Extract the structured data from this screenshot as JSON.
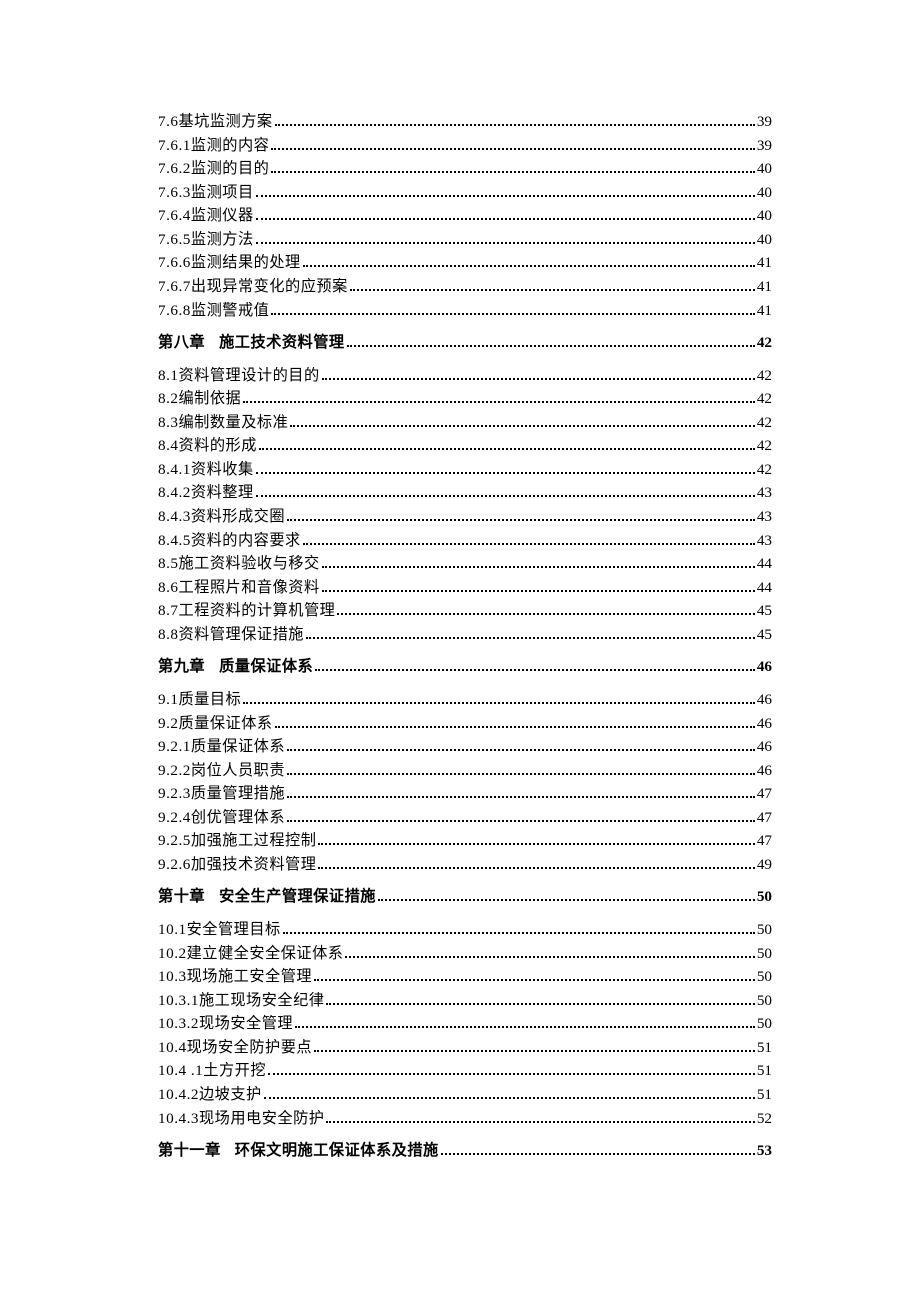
{
  "toc": [
    {
      "num": "7.6",
      "title": "基坑监测方案",
      "page": "39",
      "heading": false
    },
    {
      "num": "7.6.1",
      "title": "监测的内容",
      "page": "39",
      "heading": false
    },
    {
      "num": "7.6.2",
      "title": "监测的目的",
      "page": "40",
      "heading": false
    },
    {
      "num": "7.6.3",
      "title": "监测项目",
      "page": "40",
      "heading": false
    },
    {
      "num": "7.6.4",
      "title": "监测仪器",
      "page": "40",
      "heading": false
    },
    {
      "num": "7.6.5",
      "title": "监测方法",
      "page": "40",
      "heading": false
    },
    {
      "num": "7.6.6",
      "title": "监测结果的处理",
      "page": "41",
      "heading": false
    },
    {
      "num": "7.6.7",
      "title": "出现异常变化的应预案",
      "page": "41",
      "heading": false
    },
    {
      "num": "7.6.8",
      "title": "监测警戒值",
      "page": "41",
      "heading": false
    },
    {
      "num": "第八章",
      "title": "施工技术资料管理",
      "page": "42",
      "heading": true
    },
    {
      "num": "8.1",
      "title": "资料管理设计的目的",
      "page": "42",
      "heading": false
    },
    {
      "num": "8.2",
      "title": "编制依据",
      "page": "42",
      "heading": false
    },
    {
      "num": "8.3",
      "title": "编制数量及标准",
      "page": "42",
      "heading": false
    },
    {
      "num": "8.4",
      "title": "资料的形成",
      "page": "42",
      "heading": false
    },
    {
      "num": "8.4.1",
      "title": "资料收集",
      "page": "42",
      "heading": false
    },
    {
      "num": "8.4.2",
      "title": "资料整理",
      "page": "43",
      "heading": false
    },
    {
      "num": "8.4.3",
      "title": "资料形成交圈",
      "page": "43",
      "heading": false
    },
    {
      "num": "8.4.5",
      "title": "资料的内容要求",
      "page": "43",
      "heading": false
    },
    {
      "num": "8.5",
      "title": "施工资料验收与移交",
      "page": "44",
      "heading": false
    },
    {
      "num": "8.6",
      "title": "工程照片和音像资料",
      "page": "44",
      "heading": false
    },
    {
      "num": "8.7",
      "title": "工程资料的计算机管理",
      "page": "45",
      "heading": false
    },
    {
      "num": "8.8",
      "title": "资料管理保证措施",
      "page": "45",
      "heading": false
    },
    {
      "num": "第九章",
      "title": "质量保证体系",
      "page": "46",
      "heading": true
    },
    {
      "num": "9.1",
      "title": "质量目标",
      "page": "46",
      "heading": false
    },
    {
      "num": "9.2",
      "title": "质量保证体系",
      "page": "46",
      "heading": false
    },
    {
      "num": "9.2.1",
      "title": "质量保证体系 ",
      "page": "46",
      "heading": false
    },
    {
      "num": "9.2.2",
      "title": "岗位人员职责 ",
      "page": "46",
      "heading": false
    },
    {
      "num": "9.2.3",
      "title": "质量管理措施 ",
      "page": "47",
      "heading": false
    },
    {
      "num": "9.2.4",
      "title": "创优管理体系 ",
      "page": "47",
      "heading": false
    },
    {
      "num": "9.2.5",
      "title": "加强施工过程控制 ",
      "page": "47",
      "heading": false
    },
    {
      "num": "9.2.6",
      "title": "加强技术资料管理",
      "page": "49",
      "heading": false
    },
    {
      "num": "第十章",
      "title": "安全生产管理保证措施",
      "page": "50",
      "heading": true
    },
    {
      "num": "10.1",
      "title": "安全管理目标",
      "page": "50",
      "heading": false
    },
    {
      "num": "10.2",
      "title": "建立健全安全保证体系",
      "page": "50",
      "heading": false
    },
    {
      "num": "10.3",
      "title": "现场施工安全管理",
      "page": "50",
      "heading": false
    },
    {
      "num": "10.3.1",
      "title": "施工现场安全纪律 ",
      "page": "50",
      "heading": false
    },
    {
      "num": "10.3.2",
      "title": "现场安全管理 ",
      "page": "50",
      "heading": false
    },
    {
      "num": "10.4",
      "title": "现场安全防护要点",
      "page": "51",
      "heading": false
    },
    {
      "num": "10.4 .1",
      "title": "土方开挖",
      "page": "51",
      "heading": false
    },
    {
      "num": "10.4.2",
      "title": "边坡支护 ",
      "page": "51",
      "heading": false
    },
    {
      "num": "10.4.3",
      "title": "现场用电安全防护 ",
      "page": "52",
      "heading": false
    },
    {
      "num": "第十一章",
      "title": "环保文明施工保证体系及措施",
      "page": "53",
      "heading": true
    }
  ]
}
